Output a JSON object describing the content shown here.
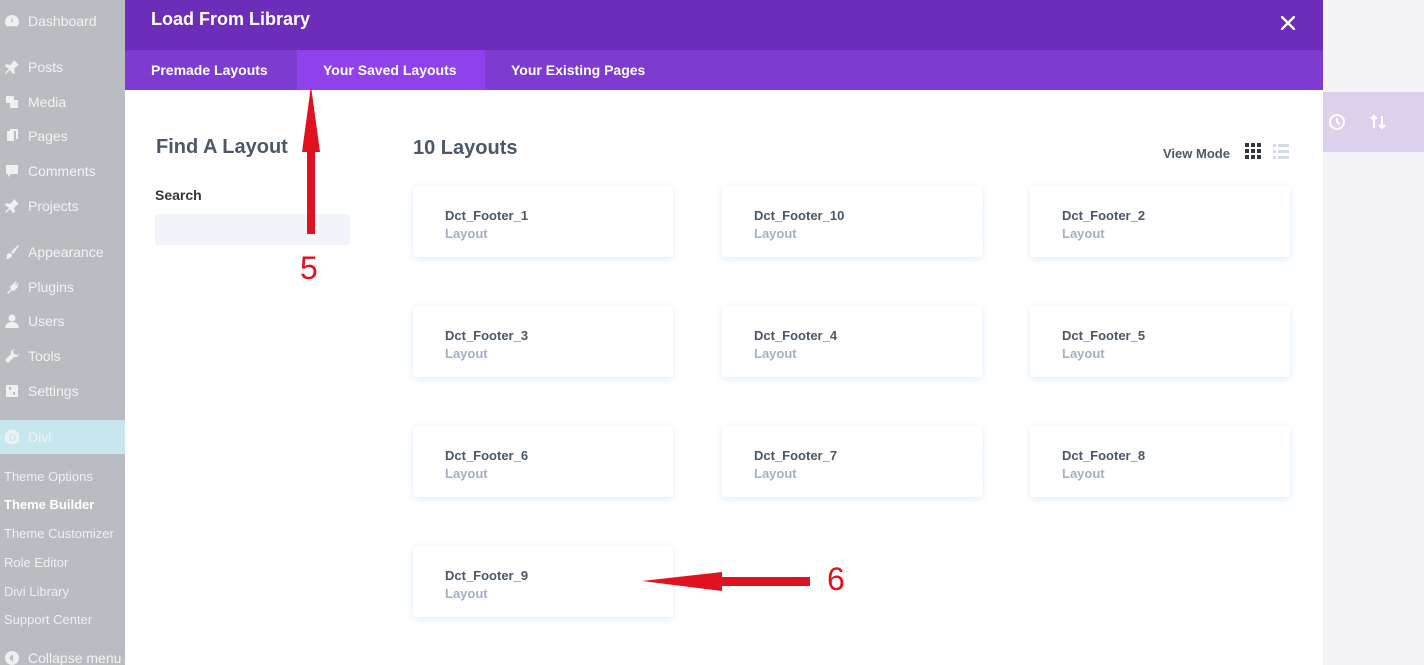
{
  "wp_sidebar": {
    "items": [
      {
        "label": "Dashboard",
        "icon": "dashboard-icon"
      },
      {
        "label": "Posts",
        "icon": "pin-icon"
      },
      {
        "label": "Media",
        "icon": "media-icon"
      },
      {
        "label": "Pages",
        "icon": "pages-icon"
      },
      {
        "label": "Comments",
        "icon": "comment-icon"
      },
      {
        "label": "Projects",
        "icon": "pin-icon"
      },
      {
        "label": "Appearance",
        "icon": "brush-icon"
      },
      {
        "label": "Plugins",
        "icon": "plug-icon"
      },
      {
        "label": "Users",
        "icon": "user-icon"
      },
      {
        "label": "Tools",
        "icon": "wrench-icon"
      },
      {
        "label": "Settings",
        "icon": "settings-icon"
      },
      {
        "label": "Divi",
        "icon": "divi-icon"
      }
    ],
    "divi_submenu": [
      "Theme Options",
      "Theme Builder",
      "Theme Customizer",
      "Role Editor",
      "Divi Library",
      "Support Center"
    ],
    "collapse_label": "Collapse menu"
  },
  "modal": {
    "title": "Load From Library",
    "tabs": [
      {
        "label": "Premade Layouts",
        "active": false
      },
      {
        "label": "Your Saved Layouts",
        "active": true
      },
      {
        "label": "Your Existing Pages",
        "active": false
      }
    ],
    "filter": {
      "title": "Find A Layout",
      "search_label": "Search",
      "search_value": ""
    },
    "list": {
      "count_label": "10 Layouts",
      "view_mode_label": "View Mode",
      "cards": [
        {
          "name": "Dct_Footer_1",
          "type": "Layout"
        },
        {
          "name": "Dct_Footer_10",
          "type": "Layout"
        },
        {
          "name": "Dct_Footer_2",
          "type": "Layout"
        },
        {
          "name": "Dct_Footer_3",
          "type": "Layout"
        },
        {
          "name": "Dct_Footer_4",
          "type": "Layout"
        },
        {
          "name": "Dct_Footer_5",
          "type": "Layout"
        },
        {
          "name": "Dct_Footer_6",
          "type": "Layout"
        },
        {
          "name": "Dct_Footer_7",
          "type": "Layout"
        },
        {
          "name": "Dct_Footer_8",
          "type": "Layout"
        },
        {
          "name": "Dct_Footer_9",
          "type": "Layout"
        }
      ]
    }
  },
  "annotations": {
    "step_5": "5",
    "step_6": "6"
  },
  "colors": {
    "header": "#6c2eb9",
    "tab_bar": "#7e3bd0",
    "tab_active": "#8f42ec",
    "annotation": "#e1121f"
  }
}
